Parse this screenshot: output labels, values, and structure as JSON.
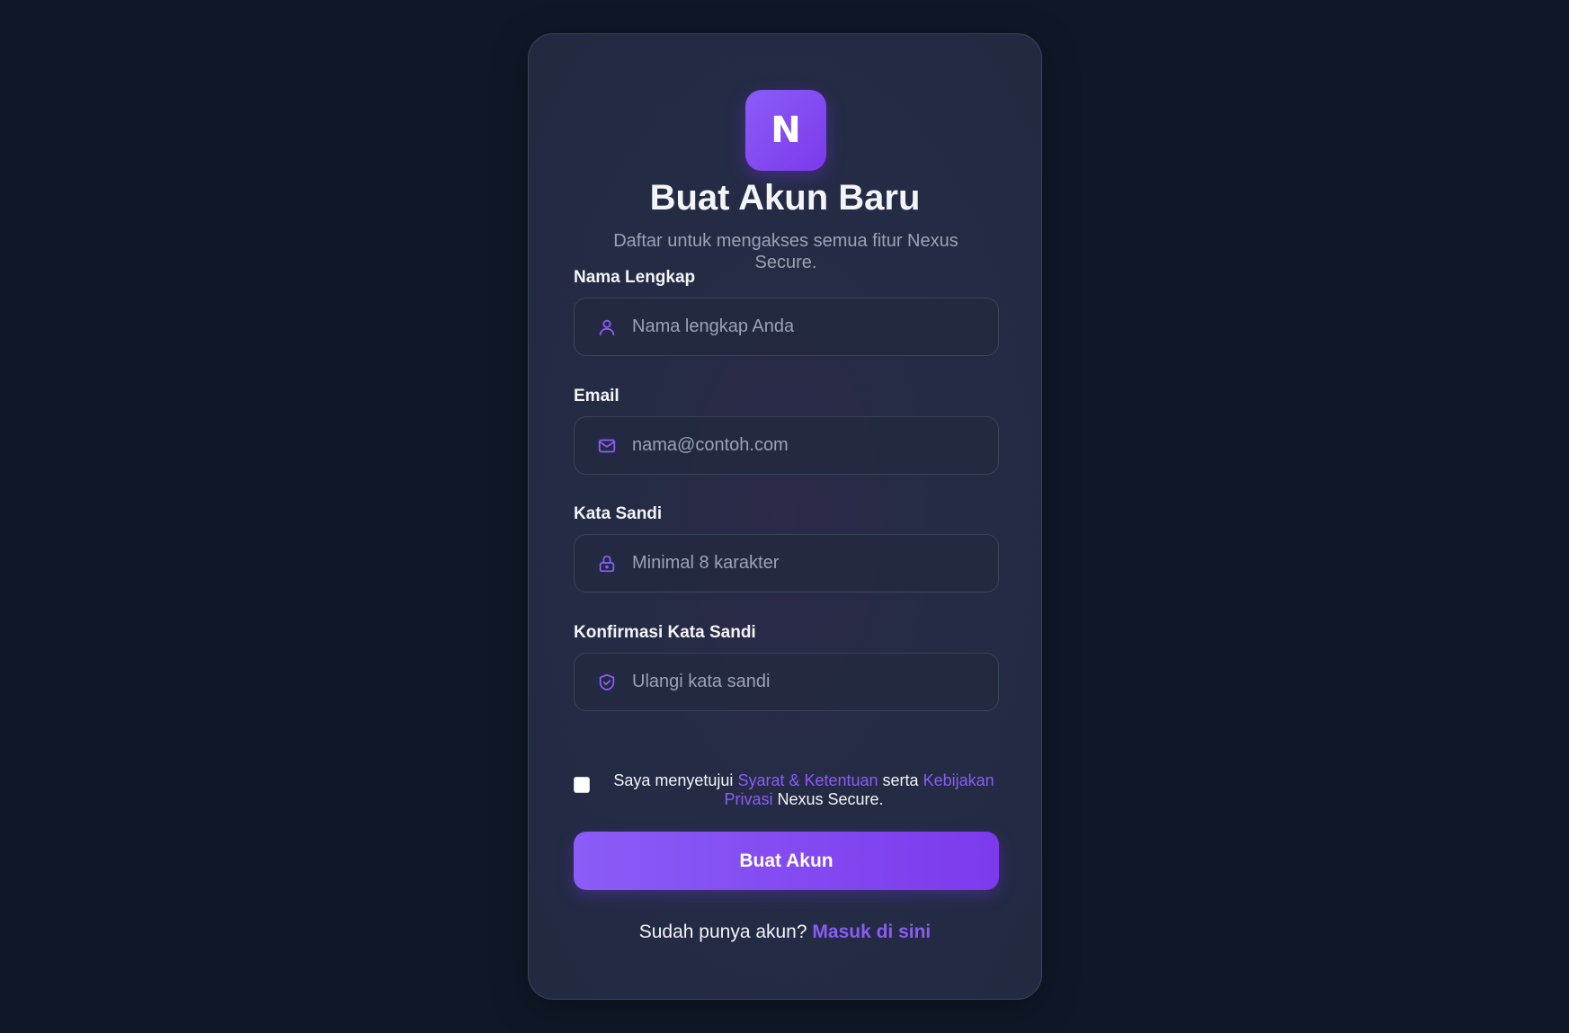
{
  "brand": {
    "logo_letter": "N",
    "accent_color": "#8b5cf6",
    "background_color": "#101828"
  },
  "header": {
    "title": "Buat Akun Baru",
    "subtitle": "Daftar untuk mengakses semua fitur Nexus Secure."
  },
  "form": {
    "full_name": {
      "label": "Nama Lengkap",
      "placeholder": "Nama lengkap Anda",
      "value": "",
      "icon": "user-icon"
    },
    "email": {
      "label": "Email",
      "placeholder": "nama@contoh.com",
      "value": "",
      "icon": "mail-icon"
    },
    "password": {
      "label": "Kata Sandi",
      "placeholder": "Minimal 8 karakter",
      "value": "",
      "icon": "lock-icon"
    },
    "confirm_password": {
      "label": "Konfirmasi Kata Sandi",
      "placeholder": "Ulangi kata sandi",
      "value": "",
      "icon": "shield-check-icon"
    },
    "agreement": {
      "checked": false,
      "prefix": "Saya menyetujui ",
      "terms_link": "Syarat & Ketentuan",
      "middle": " serta ",
      "privacy_link": "Kebijakan Privasi",
      "suffix": " Nexus Secure."
    },
    "submit_label": "Buat Akun"
  },
  "footer": {
    "prompt": "Sudah punya akun? ",
    "login_link": "Masuk di sini"
  }
}
